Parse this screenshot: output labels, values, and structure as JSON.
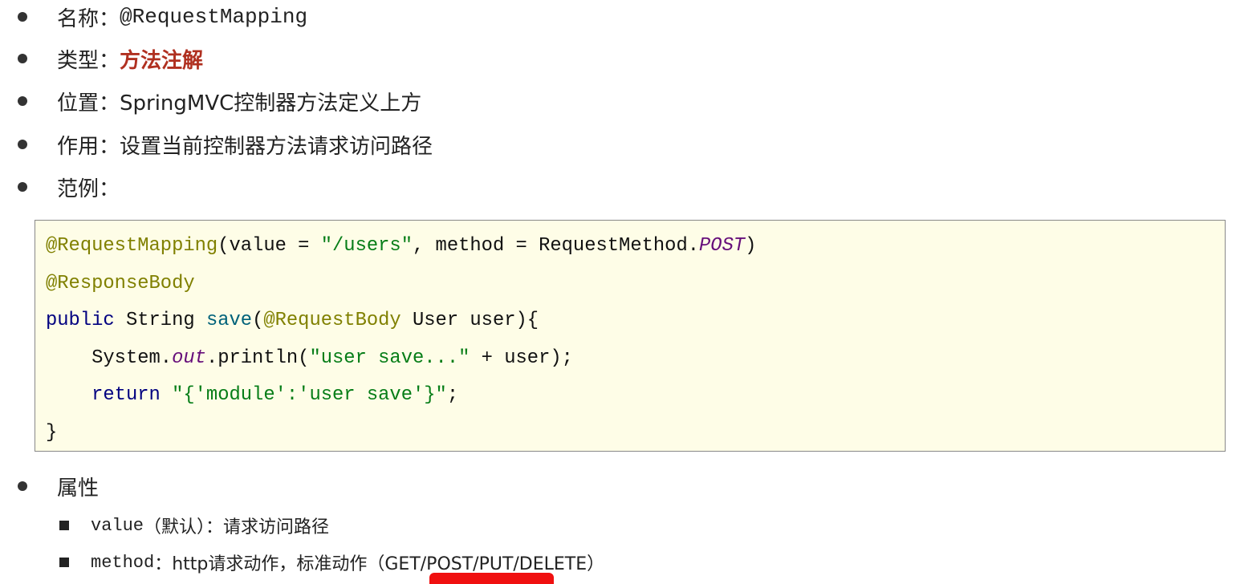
{
  "items": [
    {
      "label": "名称：",
      "value": "@RequestMapping"
    },
    {
      "label": "类型：",
      "value": "方法注解"
    },
    {
      "label": "位置：",
      "value": "SpringMVC控制器方法定义上方"
    },
    {
      "label": "作用：",
      "value": "设置当前控制器方法请求访问路径"
    },
    {
      "label": "范例：",
      "value": ""
    }
  ],
  "code": {
    "l1": {
      "ann": "@RequestMapping",
      "a": "(value = ",
      "s": "\"/users\"",
      "b": ", method = RequestMethod.",
      "c": "POST",
      "d": ")"
    },
    "l2": {
      "ann": "@ResponseBody"
    },
    "l3": {
      "kw": "public",
      "a": " String ",
      "fn": "save",
      "b": "(",
      "ann": "@RequestBody",
      "c": " User user){"
    },
    "l4": {
      "a": "    System.",
      "it": "out",
      "b": ".println(",
      "s": "\"user save...\"",
      "c": " + user);"
    },
    "l5": {
      "kw": "    return",
      "a": " ",
      "s": "\"{'module':'user save'}\"",
      "b": ";"
    },
    "l6": {
      "a": "}"
    }
  },
  "attributes": {
    "label": "属性",
    "sub": [
      {
        "key": "value",
        "text": "（默认）：请求访问路径"
      },
      {
        "key": "method",
        "text": "：http请求动作，标准动作（GET/POST/PUT/DELETE）"
      }
    ]
  },
  "colors": {
    "accent": "#b03020",
    "code_bg": "#fefde7",
    "annotation": "#808000",
    "keyword": "#000080",
    "string": "#067d17"
  }
}
